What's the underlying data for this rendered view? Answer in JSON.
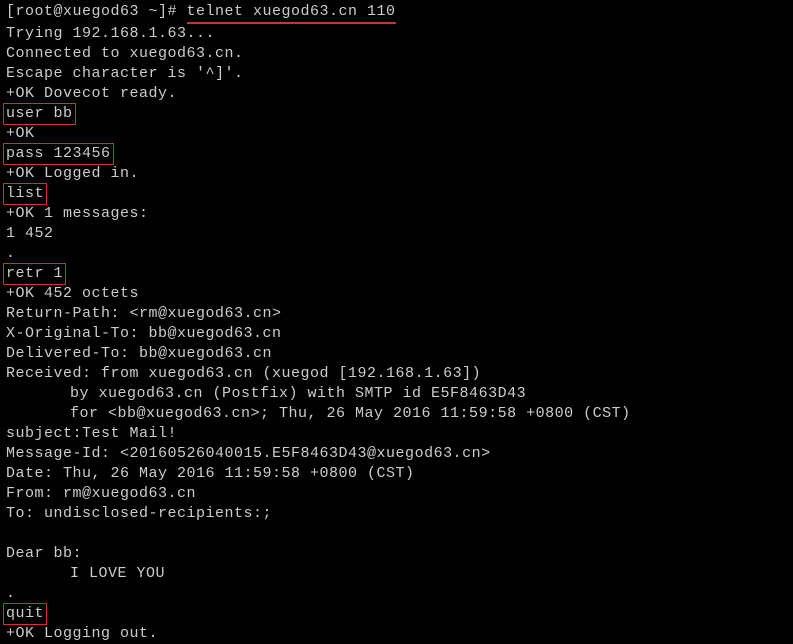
{
  "prompt": "[root@xuegod63 ~]# ",
  "command": "telnet xuegod63.cn 110",
  "lines": {
    "trying": "Trying 192.168.1.63...",
    "connected": "Connected to xuegod63.cn.",
    "escape": "Escape character is '^]'.",
    "dovecot": "+OK Dovecot ready."
  },
  "input": {
    "user": "user bb",
    "user_ok": "+OK",
    "pass": "pass 123456",
    "pass_ok": "+OK Logged in.",
    "list": "list",
    "list_ok": "+OK 1 messages:",
    "list_item": "1 452",
    "dot1": ".",
    "retr": "retr 1",
    "retr_ok": "+OK 452 octets"
  },
  "mail": {
    "return_path": "Return-Path: <rm@xuegod63.cn>",
    "x_original": "X-Original-To: bb@xuegod63.cn",
    "delivered": "Delivered-To: bb@xuegod63.cn",
    "received1": "Received: from xuegod63.cn (xuegod [192.168.1.63])",
    "received2": "by xuegod63.cn (Postfix) with SMTP id E5F8463D43",
    "received3": "for <bb@xuegod63.cn>; Thu, 26 May 2016 11:59:58 +0800 (CST)",
    "subject": "subject:Test Mail!",
    "msgid": "Message-Id: <20160526040015.E5F8463D43@xuegod63.cn>",
    "date": "Date: Thu, 26 May 2016 11:59:58 +0800 (CST)",
    "from": "From: rm@xuegod63.cn",
    "to": "To: undisclosed-recipients:;",
    "blank": " ",
    "body1": "Dear bb:",
    "body2": "I LOVE YOU",
    "dot2": "."
  },
  "quit": {
    "cmd": "quit",
    "ok": "+OK Logging out."
  }
}
